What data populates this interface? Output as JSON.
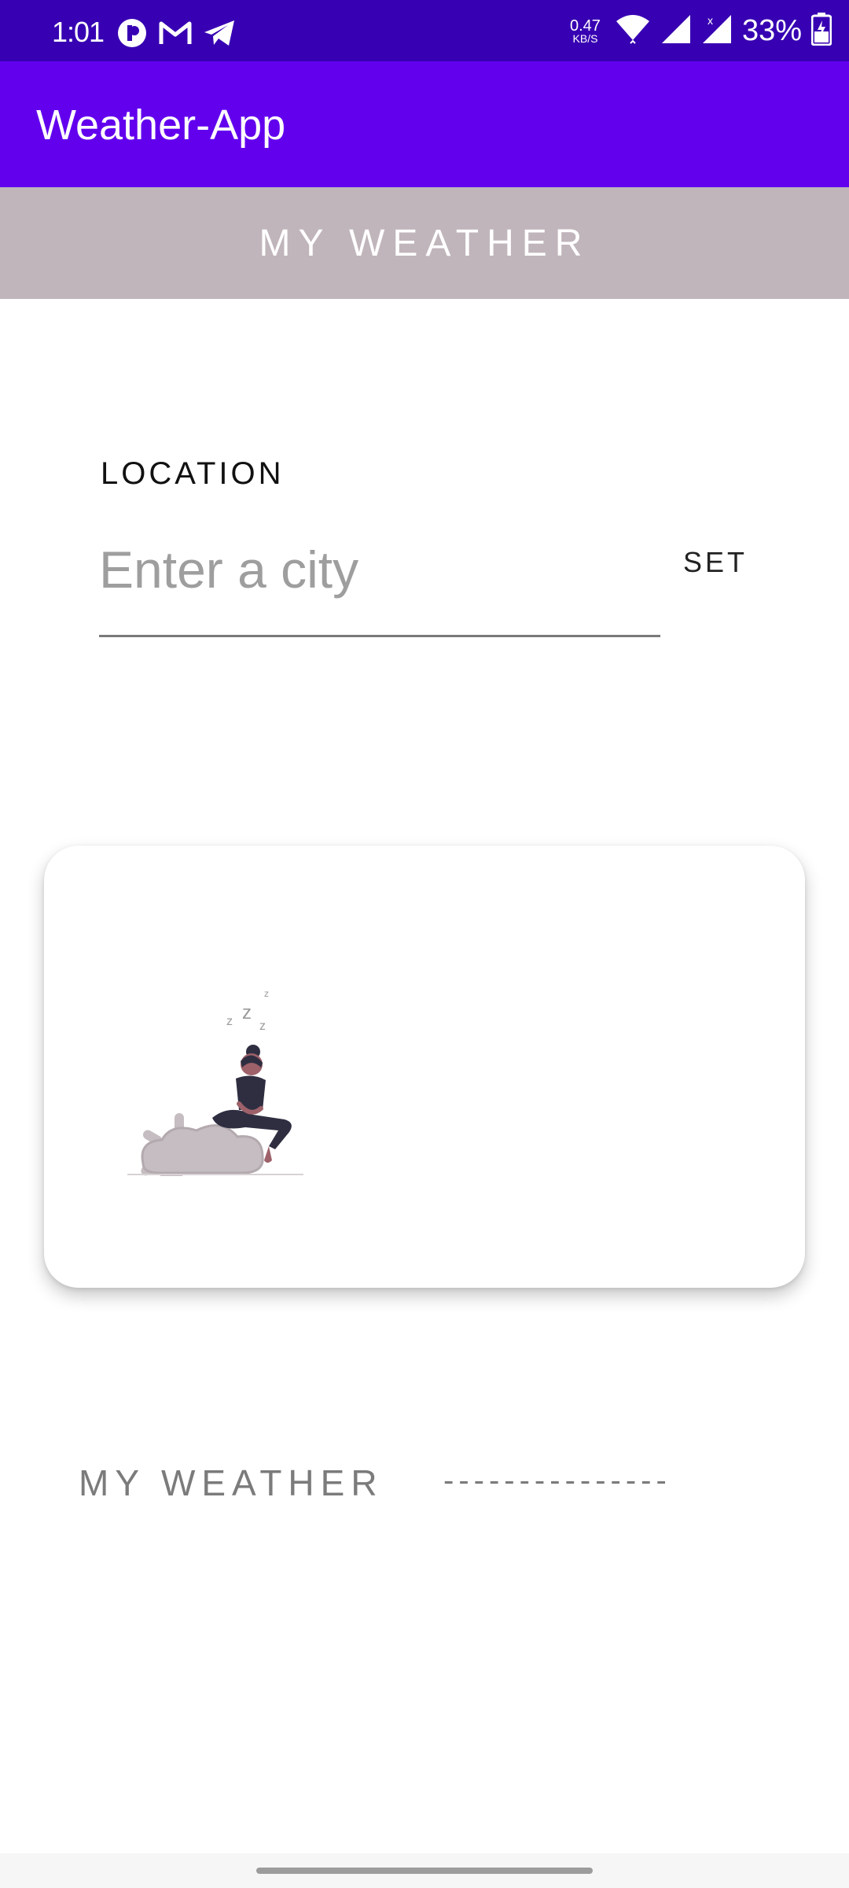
{
  "status_bar": {
    "time": "1:01",
    "net_speed_value": "0.47",
    "net_speed_unit": "KB/S",
    "battery": "33%",
    "icons": [
      "app-icon",
      "gmail-icon",
      "telegram-icon",
      "wifi-icon",
      "signal-icon",
      "signal-no-data-icon",
      "battery-charging-icon"
    ]
  },
  "app_bar": {
    "title": "Weather-App"
  },
  "header": {
    "title": "MY WEATHER"
  },
  "location": {
    "label": "LOCATION",
    "input_value": "",
    "input_placeholder": "Enter a city",
    "set_label": "SET"
  },
  "card": {
    "illustration": "person-sitting-on-cloud-with-sun-illustration"
  },
  "weather": {
    "label": "MY WEATHER",
    "value": "---------------"
  },
  "colors": {
    "status_bar": "#3700b3",
    "app_bar": "#6200ee",
    "header_banner": "#c0b5bb",
    "muted_text": "#7b7b7b"
  }
}
